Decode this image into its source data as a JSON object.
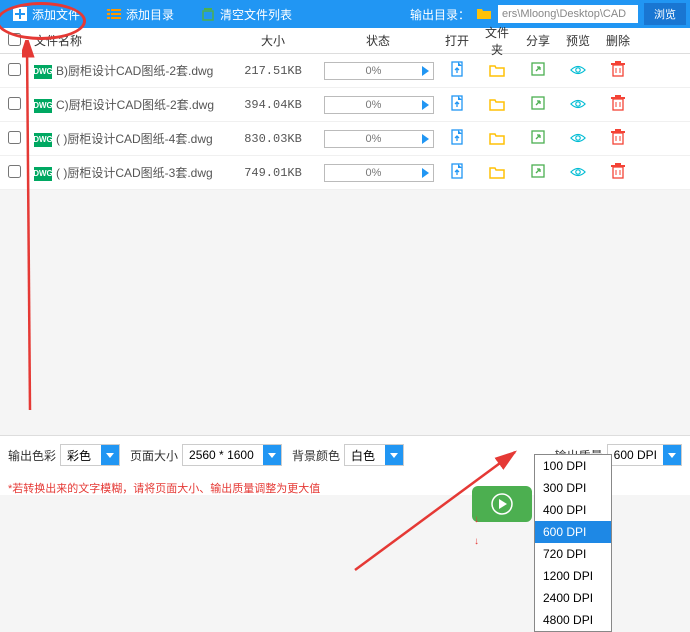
{
  "toolbar": {
    "add_file": "添加文件",
    "add_folder": "添加目录",
    "clear_list": "清空文件列表",
    "output_dir_label": "输出目录：",
    "output_path": "ers\\Mloong\\Desktop\\CAD",
    "browse": "浏览"
  },
  "headers": {
    "name": "文件名称",
    "size": "大小",
    "status": "状态",
    "open": "打开",
    "folder": "文件夹",
    "share": "分享",
    "preview": "预览",
    "delete": "删除"
  },
  "files": [
    {
      "icon_label": "DWG",
      "name": "B)厨柜设计CAD图纸-2套.dwg",
      "size": "217.51KB",
      "progress": "0%"
    },
    {
      "icon_label": "DWG",
      "name": "C)厨柜设计CAD图纸-2套.dwg",
      "size": "394.04KB",
      "progress": "0%"
    },
    {
      "icon_label": "DWG",
      "name": "( )厨柜设计CAD图纸-4套.dwg",
      "size": "830.03KB",
      "progress": "0%"
    },
    {
      "icon_label": "DWG",
      "name": "( )厨柜设计CAD图纸-3套.dwg",
      "size": "749.01KB",
      "progress": "0%"
    }
  ],
  "settings": {
    "color_label": "输出色彩",
    "color_value": "彩色",
    "page_size_label": "页面大小",
    "page_size_value": "2560 * 1600",
    "bg_color_label": "背景颜色",
    "bg_color_value": "白色",
    "quality_label": "输出质量",
    "quality_value": "600 DPI"
  },
  "hint": "*若转换出来的文字模糊，请将页面大小、输出质量调整为更大值",
  "dpi_options": [
    "100 DPI",
    "300 DPI",
    "400 DPI",
    "600 DPI",
    "720 DPI",
    "1200 DPI",
    "2400 DPI",
    "4800 DPI"
  ],
  "dpi_selected": "600 DPI"
}
